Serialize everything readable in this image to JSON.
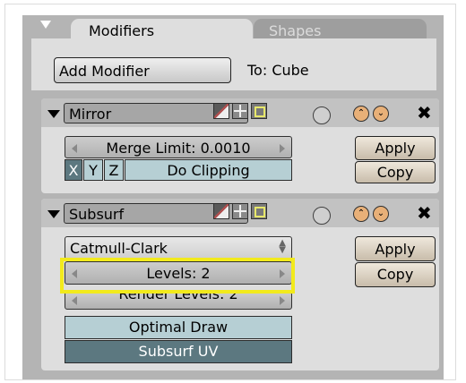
{
  "tabs": {
    "active": "Modifiers",
    "inactive": "Shapes"
  },
  "add_modifier_label": "Add Modifier",
  "target_label": "To: Cube",
  "mirror": {
    "name": "Mirror",
    "merge_limit": "Merge Limit: 0.0010",
    "axis_x": "X",
    "axis_y": "Y",
    "axis_z": "Z",
    "do_clipping": "Do Clipping",
    "apply": "Apply",
    "copy": "Copy"
  },
  "subsurf": {
    "name": "Subsurf",
    "subdivision_type": "Catmull-Clark",
    "levels": "Levels: 2",
    "render_levels": "Render Levels: 2",
    "optimal_draw": "Optimal Draw",
    "subsurf_uv": "Subsurf UV",
    "apply": "Apply",
    "copy": "Copy"
  },
  "controls": {
    "move_up": "⌃",
    "move_down": "⌄",
    "remove": "✖"
  },
  "colors": {
    "highlight": "#f2ea1c",
    "toggle_on": "#5c7880",
    "toggle_off": "#b6cfd4",
    "updown": "#e8b078"
  }
}
